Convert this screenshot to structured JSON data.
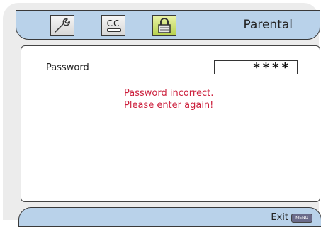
{
  "header": {
    "tabs": [
      {
        "icon": "wrench-icon"
      },
      {
        "icon": "closed-caption-icon",
        "text": "CC"
      },
      {
        "icon": "lock-icon"
      }
    ],
    "title": "Parental"
  },
  "main": {
    "password_label": "Password",
    "password_value": "****",
    "error_line1": "Password incorrect.",
    "error_line2": "Please enter again!"
  },
  "footer": {
    "exit_label": "Exit",
    "menu_key_label": "MENU"
  },
  "colors": {
    "bar_background": "#b9d2ea",
    "error_text": "#cc1f3c",
    "lock_tab_highlight": "#b7d14e"
  }
}
